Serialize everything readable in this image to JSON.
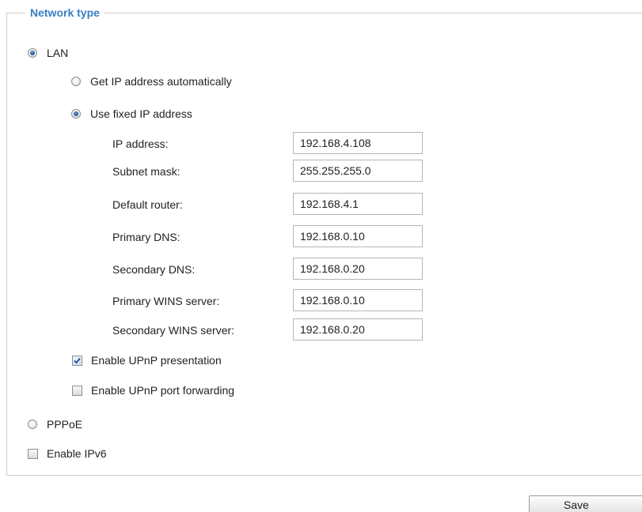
{
  "section": {
    "legend": "Network type"
  },
  "network_type": {
    "lan_label": "LAN",
    "lan_checked": true,
    "pppoe_label": "PPPoE",
    "pppoe_checked": false
  },
  "ip_mode": {
    "auto_label": "Get IP address automatically",
    "auto_checked": false,
    "fixed_label": "Use fixed IP address",
    "fixed_checked": true
  },
  "fields": {
    "ip_address": {
      "label": "IP address:",
      "value": "192.168.4.108"
    },
    "subnet_mask": {
      "label": "Subnet mask:",
      "value": "255.255.255.0"
    },
    "default_router": {
      "label": "Default router:",
      "value": "192.168.4.1"
    },
    "primary_dns": {
      "label": "Primary DNS:",
      "value": "192.168.0.10"
    },
    "secondary_dns": {
      "label": "Secondary DNS:",
      "value": "192.168.0.20"
    },
    "primary_wins": {
      "label": "Primary WINS server:",
      "value": "192.168.0.10"
    },
    "secondary_wins": {
      "label": "Secondary WINS server:",
      "value": "192.168.0.20"
    }
  },
  "options": {
    "upnp_presentation_label": "Enable UPnP presentation",
    "upnp_presentation_checked": true,
    "upnp_port_forwarding_label": "Enable UPnP port forwarding",
    "upnp_port_forwarding_checked": false,
    "ipv6_label": "Enable IPv6",
    "ipv6_checked": false
  },
  "actions": {
    "save_label": "Save"
  },
  "colors": {
    "legend": "#3a7fc4",
    "border": "#c9c9c9",
    "text": "#222222"
  }
}
